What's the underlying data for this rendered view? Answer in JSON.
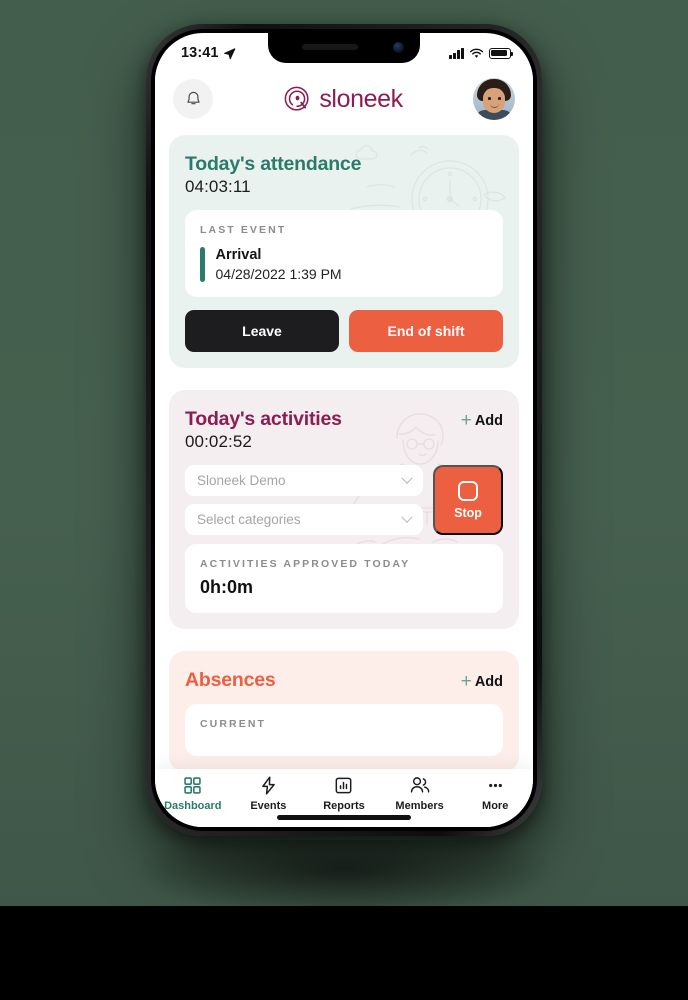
{
  "status_bar": {
    "time": "13:41",
    "location_icon": "location-arrow-icon",
    "signal_icon": "cellular-signal-icon",
    "wifi_icon": "wifi-icon",
    "battery_icon": "battery-icon"
  },
  "header": {
    "bell_icon": "notification-bell-icon",
    "logo_mark": "sloneek-logo-mark",
    "logo_text": "sloneek",
    "avatar": "user-avatar"
  },
  "attendance": {
    "title": "Today's attendance",
    "timer": "04:03:11",
    "last_event_label": "LAST EVENT",
    "event_name": "Arrival",
    "event_time": "04/28/2022 1:39 PM",
    "leave_label": "Leave",
    "end_shift_label": "End of shift",
    "art": "clock-and-clouds-illustration",
    "accent_color": "#2c7a6b",
    "background": "#eaf2f0"
  },
  "activities": {
    "title": "Today's activities",
    "timer": "00:02:52",
    "add_label": "Add",
    "project_value": "Sloneek Demo",
    "categories_placeholder": "Select categories",
    "stop_label": "Stop",
    "approved_label": "ACTIVITIES APPROVED TODAY",
    "approved_value": "0h:0m",
    "art": "person-at-desk-illustration",
    "accent_color": "#8b1d54",
    "background": "#f4eef1"
  },
  "absences": {
    "title": "Absences",
    "add_label": "Add",
    "current_label": "CURRENT",
    "accent_color": "#ec5f41",
    "background": "#fdeeea"
  },
  "tabbar": {
    "items": [
      {
        "label": "Dashboard",
        "icon": "grid-squares-icon",
        "active": true
      },
      {
        "label": "Events",
        "icon": "lightning-bolt-icon",
        "active": false
      },
      {
        "label": "Reports",
        "icon": "bar-chart-icon",
        "active": false
      },
      {
        "label": "Members",
        "icon": "people-icon",
        "active": false
      },
      {
        "label": "More",
        "icon": "ellipsis-icon",
        "active": false
      }
    ]
  }
}
